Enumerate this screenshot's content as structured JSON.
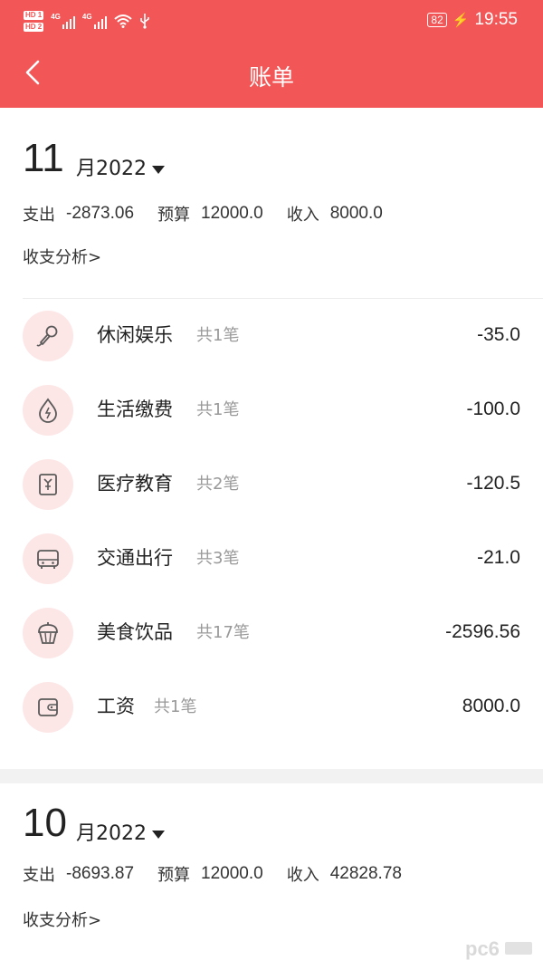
{
  "status_bar": {
    "hd1": "HD 1",
    "hd2": "HD 2",
    "net1": "4G",
    "net2": "4G",
    "battery": "82",
    "time": "19:55"
  },
  "navbar": {
    "title": "账单"
  },
  "months": [
    {
      "month": "11",
      "month_suffix": "月2022",
      "expense_label": "支出",
      "expense": "-2873.06",
      "budget_label": "预算",
      "budget": "12000.0",
      "income_label": "收入",
      "income": "8000.0",
      "analysis_link": "收支分析>",
      "items": [
        {
          "name": "休闲娱乐",
          "count": "共1笔",
          "amount": "-35.0",
          "icon": "microphone-icon"
        },
        {
          "name": "生活缴费",
          "count": "共1笔",
          "amount": "-100.0",
          "icon": "water-drop-icon"
        },
        {
          "name": "医疗教育",
          "count": "共2笔",
          "amount": "-120.5",
          "icon": "medical-box-icon"
        },
        {
          "name": "交通出行",
          "count": "共3笔",
          "amount": "-21.0",
          "icon": "bus-icon"
        },
        {
          "name": "美食饮品",
          "count": "共17笔",
          "amount": "-2596.56",
          "icon": "cupcake-icon"
        },
        {
          "name": "工资",
          "count": "共1笔",
          "amount": "8000.0",
          "icon": "wallet-icon"
        }
      ]
    },
    {
      "month": "10",
      "month_suffix": "月2022",
      "expense_label": "支出",
      "expense": "-8693.87",
      "budget_label": "预算",
      "budget": "12000.0",
      "income_label": "收入",
      "income": "42828.78",
      "analysis_link": "收支分析>"
    }
  ],
  "colors": {
    "accent": "#f25656",
    "icon_bg": "#fde6e6",
    "icon_stroke": "#5a5a5a"
  }
}
